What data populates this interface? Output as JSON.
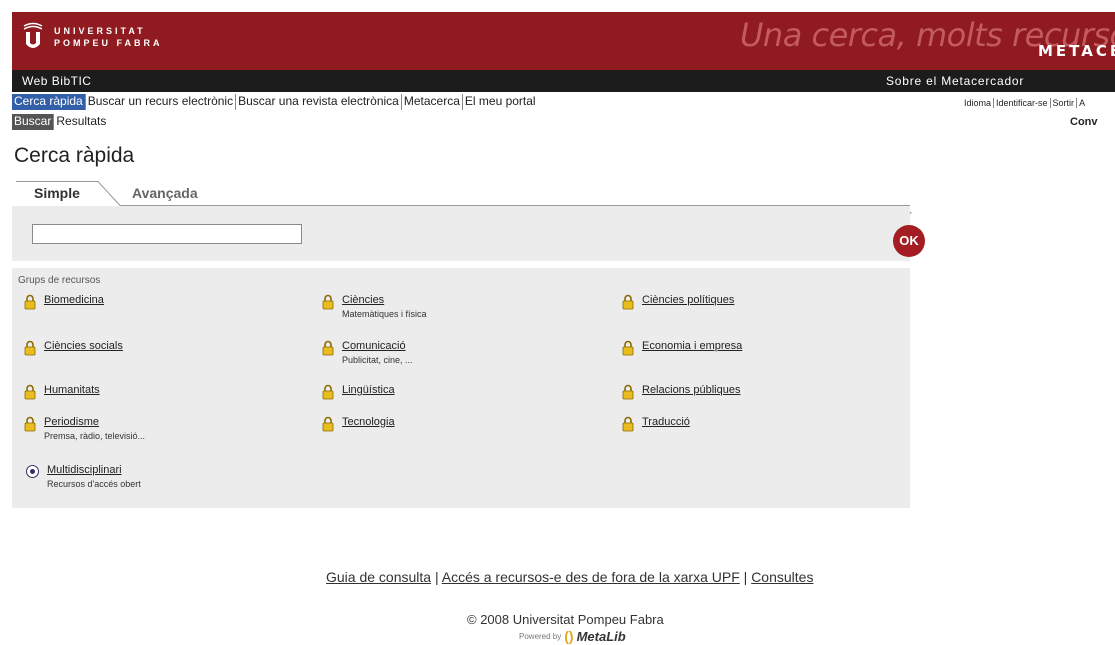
{
  "banner": {
    "logo_line1": "UNIVERSITAT",
    "logo_line2": "POMPEU FABRA",
    "slogan": "Una cerca, molts recursos",
    "brand": "METACERCADO",
    "left_title": "Web BibTIC",
    "right_link": "Sobre el Metacercador",
    "colors": {
      "red": "#8f1a1f",
      "black": "#1c1c1c",
      "accent_blue": "#335fa8"
    }
  },
  "nav": {
    "primary": [
      "Cerca ràpida",
      "Buscar un recurs electrònic",
      "Buscar una revista electrònica",
      "Metacerca",
      "El meu portal"
    ],
    "secondary": [
      "Buscar",
      "Resultats"
    ],
    "utility": [
      "Idioma",
      "Identificar-se",
      "Sortir",
      "A"
    ],
    "conv": "Conv"
  },
  "page": {
    "title": "Cerca ràpida",
    "tabs": [
      "Simple",
      "Avançada"
    ],
    "search_value": "",
    "ok_label": "OK"
  },
  "groups": {
    "title": "Grups de recursos",
    "items": [
      {
        "name": "Biomedicina",
        "sub": ""
      },
      {
        "name": "Ciències",
        "sub": "Matemàtiques i física"
      },
      {
        "name": "Ciències polítiques",
        "sub": ""
      },
      {
        "name": "Ciències socials",
        "sub": ""
      },
      {
        "name": "Comunicació",
        "sub": "Publicitat, cine, ..."
      },
      {
        "name": "Economia i empresa",
        "sub": ""
      },
      {
        "name": "Humanitats",
        "sub": ""
      },
      {
        "name": "Lingüística",
        "sub": ""
      },
      {
        "name": "Relacions públiques",
        "sub": ""
      },
      {
        "name": "Periodisme",
        "sub": "Premsa, ràdio, televisió..."
      },
      {
        "name": "Tecnologia",
        "sub": ""
      },
      {
        "name": "Traducció",
        "sub": ""
      }
    ],
    "open": {
      "name": "Multidisciplinari",
      "sub": "Recursos d'accés obert"
    }
  },
  "footer": {
    "link1": "Guia de consulta",
    "link2": "Accés a recursos-e des de fora de la xarxa UPF",
    "link3": "Consultes",
    "copyright": "© 2008 Universitat Pompeu Fabra",
    "powered_by": "Powered by",
    "metalib": "MetaLib"
  }
}
